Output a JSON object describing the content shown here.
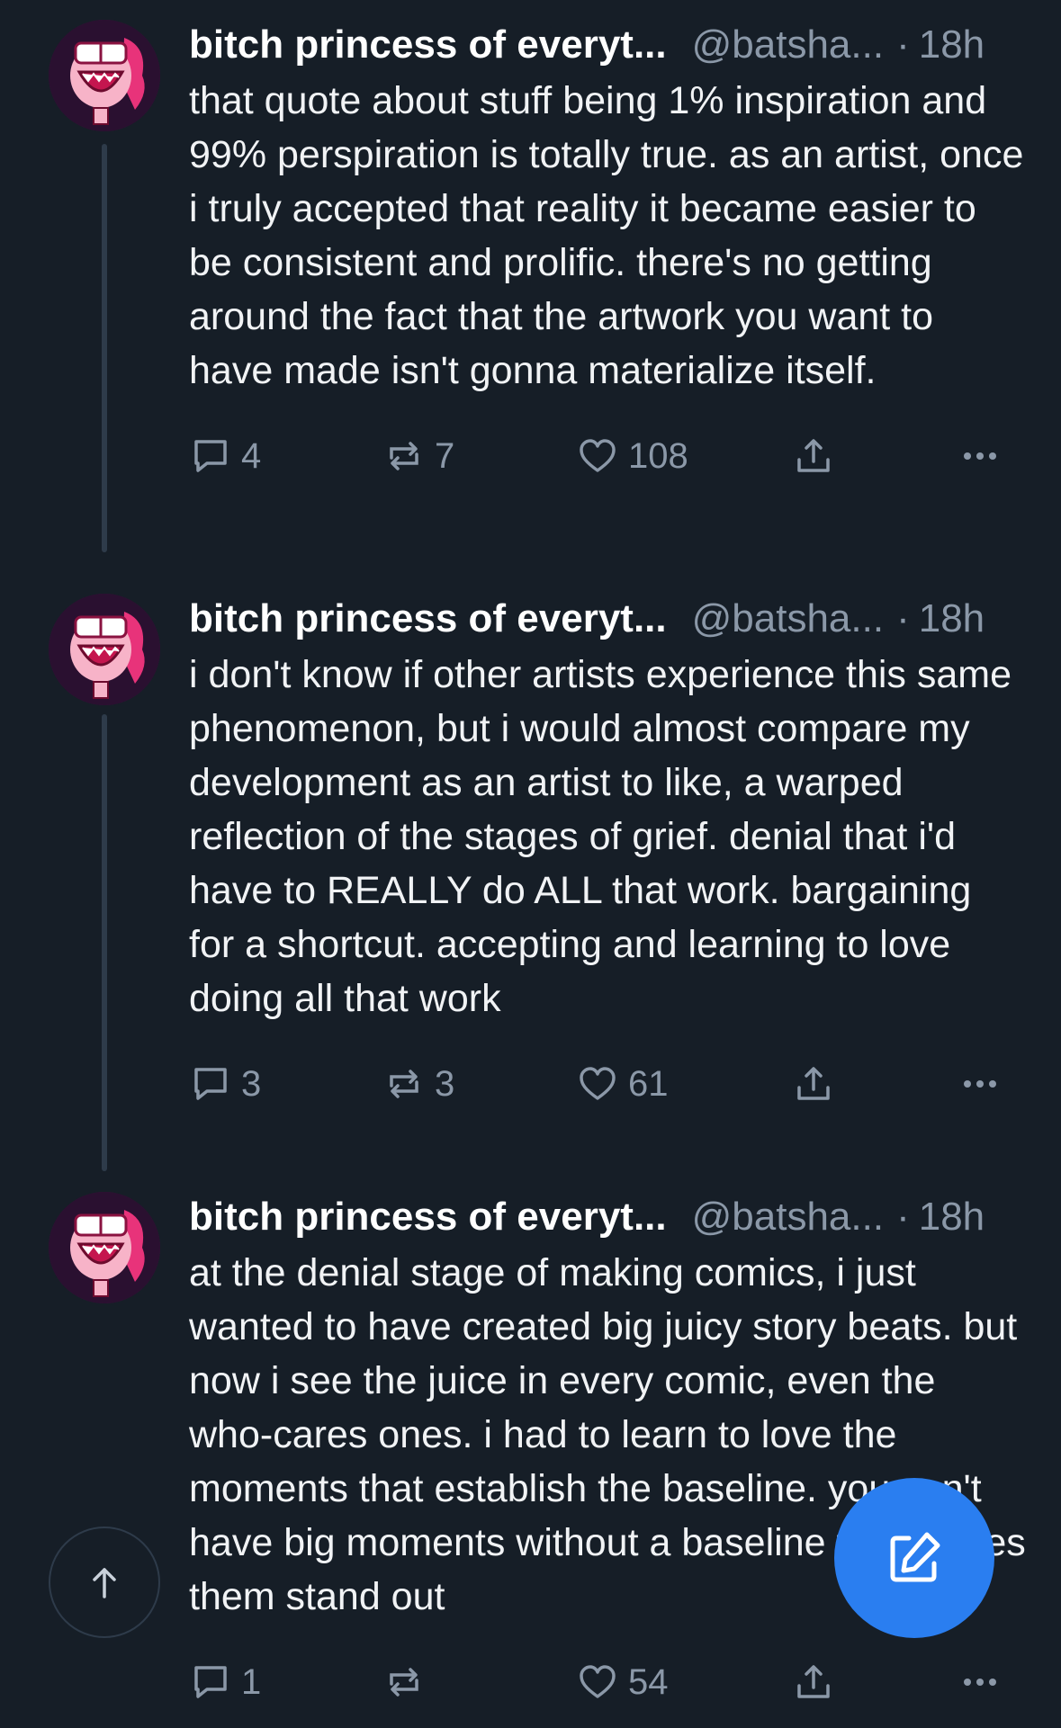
{
  "posts": [
    {
      "author": "bitch princess of everyt...",
      "handle": "@batsha...",
      "separator": "·",
      "time": "18h",
      "text": "that quote about stuff being 1% inspiration and 99% perspiration is totally true. as an artist, once i truly accepted that reality it became easier to be consistent and prolific. there's no getting around the fact that the artwork you want to have made isn't gonna materialize itself.",
      "replies": "4",
      "reposts": "7",
      "likes": "108"
    },
    {
      "author": "bitch princess of everyt...",
      "handle": "@batsha...",
      "separator": "·",
      "time": "18h",
      "text": "i don't know if other artists experience this same phenomenon, but i would almost compare my development as an artist to like, a warped reflection of the stages of grief. denial that i'd have to REALLY do ALL that work. bargaining for a shortcut. accepting and learning to love doing all that work",
      "replies": "3",
      "reposts": "3",
      "likes": "61"
    },
    {
      "author": "bitch princess of everyt...",
      "handle": "@batsha...",
      "separator": "·",
      "time": "18h",
      "text": "at the denial stage of making comics, i just wanted to have created big juicy story beats. but now i see the juice in every comic, even the who-cares ones. i had to learn to love the moments that establish the baseline. you can't have big moments without a baseline that makes them stand out",
      "replies": "1",
      "reposts": "",
      "likes": "54"
    }
  ],
  "icons": {
    "reply": "speech-bubble-icon",
    "repost": "repost-arrows-icon",
    "like": "heart-icon",
    "share": "share-upload-icon",
    "more": "ellipsis-icon",
    "scroll_top": "arrow-up-icon",
    "compose": "compose-pen-icon"
  },
  "colors": {
    "background": "#161e27",
    "muted": "#8b98a8",
    "accent": "#2a7ef0",
    "thread_line": "#2e3b4a"
  }
}
